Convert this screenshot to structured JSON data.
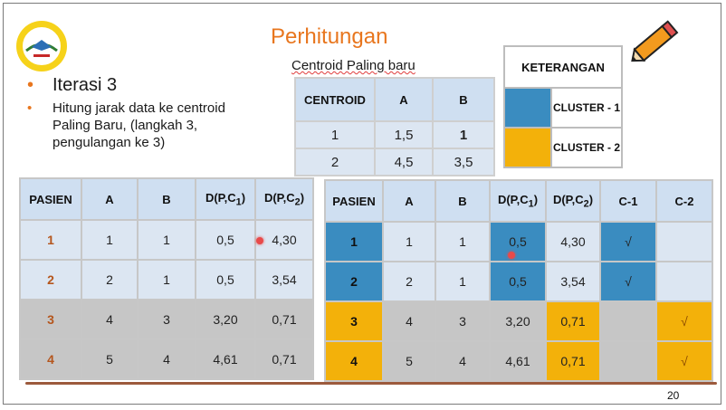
{
  "slide": {
    "title": "Perhitungan",
    "subtitle": "Centroid Paling baru",
    "bullet1": "Iterasi 3",
    "bullet2_line1": "Hitung jarak data ke centroid",
    "bullet2_line2": "Paling Baru, (langkah 3,",
    "bullet2_line3": "pengulangan ke 3)",
    "page_number": "20"
  },
  "centroid_table": {
    "headers": [
      "CENTROID",
      "A",
      "B"
    ],
    "rows": [
      [
        "1",
        "1,5",
        "1"
      ],
      [
        "2",
        "4,5",
        "3,5"
      ]
    ]
  },
  "legend": {
    "header": "KETERANGAN",
    "items": [
      {
        "label": "CLUSTER - 1",
        "color": "#3a8cc0"
      },
      {
        "label": "CLUSTER - 2",
        "color": "#f3b10a"
      }
    ]
  },
  "left_table": {
    "headers": [
      "PASIEN",
      "A",
      "B",
      "D(P,C",
      "D(P,C"
    ],
    "subs": [
      "1",
      "2"
    ],
    "rows": [
      [
        "1",
        "1",
        "1",
        "0,5",
        "4,30"
      ],
      [
        "2",
        "2",
        "1",
        "0,5",
        "3,54"
      ],
      [
        "3",
        "4",
        "3",
        "3,20",
        "0,71"
      ],
      [
        "4",
        "5",
        "4",
        "4,61",
        "0,71"
      ]
    ]
  },
  "right_table": {
    "headers": [
      "PASIEN",
      "A",
      "B",
      "D(P,C",
      "D(P,C",
      "C-1",
      "C-2"
    ],
    "subs": [
      "1",
      "2"
    ],
    "rows": [
      [
        "1",
        "1",
        "1",
        "0,5",
        "4,30",
        "√",
        ""
      ],
      [
        "2",
        "2",
        "1",
        "0,5",
        "3,54",
        "√",
        ""
      ],
      [
        "3",
        "4",
        "3",
        "3,20",
        "0,71",
        "",
        "√"
      ],
      [
        "4",
        "5",
        "4",
        "4,61",
        "0,71",
        "",
        "√"
      ]
    ]
  },
  "colors": {
    "accent": "#e8761e",
    "cluster1": "#3a8cc0",
    "cluster2": "#f3b10a"
  }
}
